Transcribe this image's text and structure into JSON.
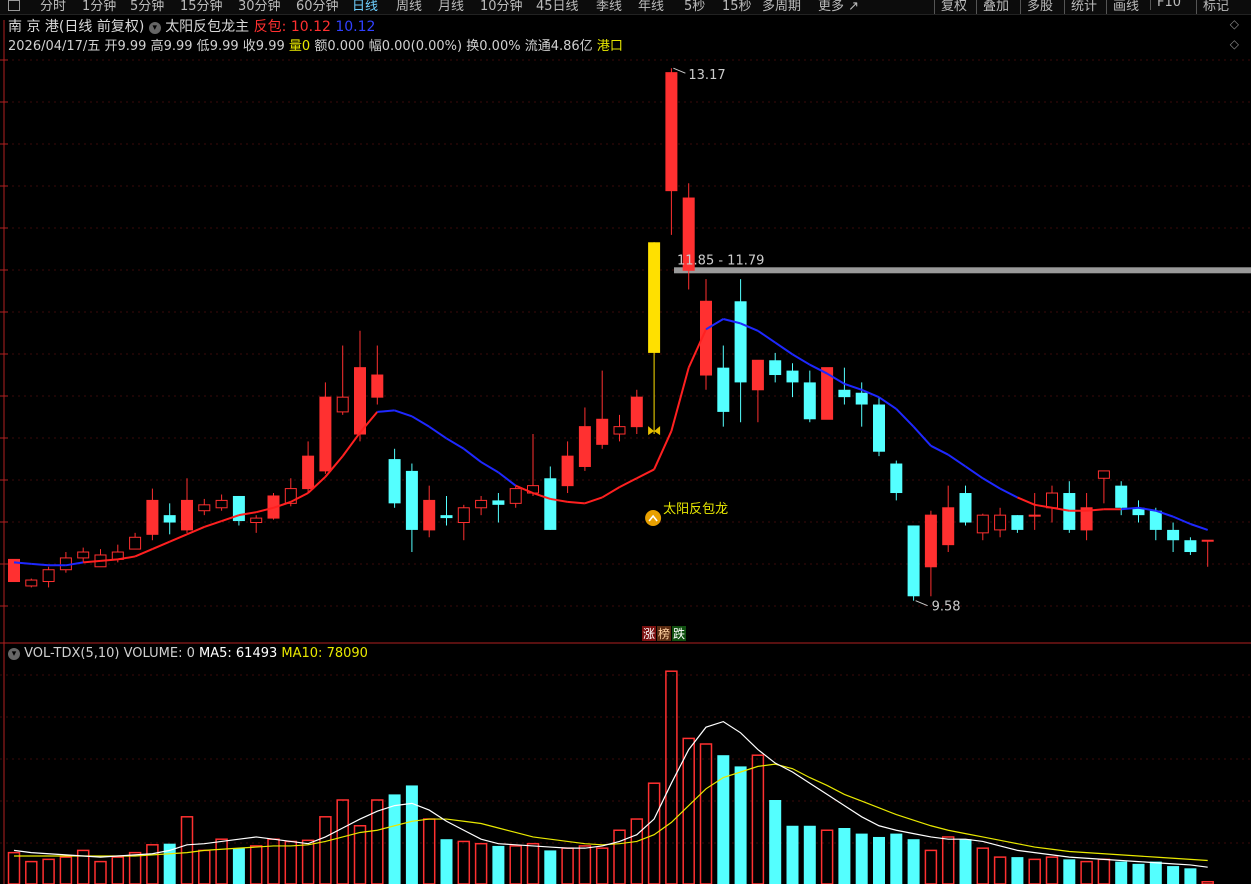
{
  "toolbar": {
    "items": [
      "分时",
      "1分钟",
      "5分钟",
      "15分钟",
      "30分钟",
      "60分钟",
      "日线",
      "周线",
      "月线",
      "10分钟",
      "45日线",
      "季线",
      "年线",
      "5秒",
      "15秒",
      "多周期",
      "更多"
    ],
    "active_index": 6,
    "right_items": [
      "复权",
      "叠加",
      "多股",
      "统计",
      "画线",
      "F10",
      "标记"
    ]
  },
  "header": {
    "stock_name": "南 京 港",
    "period": "(日线 前复权)",
    "indicator": "太阳反包龙主",
    "fanbao_label": "反包:",
    "fanbao_value": "10.12",
    "fanbao_value2": "10.12"
  },
  "quote": {
    "date": "2026/04/17/五",
    "open_label": "开",
    "open": "9.99",
    "high_label": "高",
    "high": "9.99",
    "low_label": "低",
    "low": "9.99",
    "close_label": "收",
    "close": "9.99",
    "vol_label": "量",
    "vol": "0",
    "amount_label": "额",
    "amount": "0.000",
    "change_label": "幅",
    "change": "0.00(0.00%)",
    "turnover_label": "换",
    "turnover": "0.00%",
    "float_label": "流通",
    "float_cap": "4.86亿",
    "tag": "港口"
  },
  "annotations": {
    "high_label": "13.17",
    "low_label": "9.58",
    "level_label": "11.85 - 11.79",
    "signal_text": "太阳反包龙",
    "zhang": "涨",
    "bang": "榜",
    "die": "跌"
  },
  "volume_panel": {
    "title": "VOL-TDX(5,10)",
    "volume_text": "VOLUME: 0",
    "ma5_text": "MA5: 61493",
    "ma10_text": "MA10: 78090"
  },
  "colors": {
    "up": "#ff3030",
    "down": "#54ffff",
    "ma_up": "#ff2020",
    "ma_down": "#1e28ff",
    "signal": "#ffe000",
    "vol_ma5": "#ffffff",
    "vol_ma10": "#e8e800",
    "level_line": "#9a9a9a"
  },
  "chart_data": {
    "type": "candlestick",
    "price_range": [
      9.3,
      13.3
    ],
    "volume_max": 200000,
    "candles": [
      {
        "o": 9.71,
        "c": 9.86,
        "h": 9.86,
        "l": 9.71
      },
      {
        "o": 9.68,
        "c": 9.72,
        "h": 9.73,
        "l": 9.67
      },
      {
        "o": 9.71,
        "c": 9.79,
        "h": 9.81,
        "l": 9.67
      },
      {
        "o": 9.79,
        "c": 9.87,
        "h": 9.91,
        "l": 9.77
      },
      {
        "o": 9.87,
        "c": 9.91,
        "h": 9.94,
        "l": 9.84
      },
      {
        "o": 9.81,
        "c": 9.89,
        "h": 9.93,
        "l": 9.81
      },
      {
        "o": 9.86,
        "c": 9.91,
        "h": 9.96,
        "l": 9.84
      },
      {
        "o": 9.93,
        "c": 10.01,
        "h": 10.04,
        "l": 9.93
      },
      {
        "o": 10.03,
        "c": 10.26,
        "h": 10.34,
        "l": 9.99
      },
      {
        "o": 10.16,
        "c": 10.11,
        "h": 10.24,
        "l": 10.03
      },
      {
        "o": 10.06,
        "c": 10.26,
        "h": 10.41,
        "l": 10.04
      },
      {
        "o": 10.19,
        "c": 10.23,
        "h": 10.27,
        "l": 10.16
      },
      {
        "o": 10.21,
        "c": 10.26,
        "h": 10.3,
        "l": 10.19
      },
      {
        "o": 10.29,
        "c": 10.12,
        "h": 10.29,
        "l": 10.09
      },
      {
        "o": 10.11,
        "c": 10.14,
        "h": 10.16,
        "l": 10.04
      },
      {
        "o": 10.14,
        "c": 10.29,
        "h": 10.31,
        "l": 10.13
      },
      {
        "o": 10.24,
        "c": 10.34,
        "h": 10.41,
        "l": 10.22
      },
      {
        "o": 10.34,
        "c": 10.56,
        "h": 10.66,
        "l": 10.31
      },
      {
        "o": 10.46,
        "c": 10.96,
        "h": 11.06,
        "l": 10.44
      },
      {
        "o": 10.86,
        "c": 10.96,
        "h": 11.31,
        "l": 10.84
      },
      {
        "o": 10.71,
        "c": 11.16,
        "h": 11.41,
        "l": 10.66
      },
      {
        "o": 10.96,
        "c": 11.11,
        "h": 11.31,
        "l": 10.91
      },
      {
        "o": 10.54,
        "c": 10.24,
        "h": 10.61,
        "l": 10.21
      },
      {
        "o": 10.46,
        "c": 10.06,
        "h": 10.51,
        "l": 9.91
      },
      {
        "o": 10.06,
        "c": 10.26,
        "h": 10.36,
        "l": 10.01
      },
      {
        "o": 10.16,
        "c": 10.14,
        "h": 10.29,
        "l": 10.09
      },
      {
        "o": 10.11,
        "c": 10.21,
        "h": 10.23,
        "l": 9.99
      },
      {
        "o": 10.21,
        "c": 10.26,
        "h": 10.29,
        "l": 10.16
      },
      {
        "o": 10.26,
        "c": 10.23,
        "h": 10.31,
        "l": 10.11
      },
      {
        "o": 10.24,
        "c": 10.34,
        "h": 10.36,
        "l": 10.21
      },
      {
        "o": 10.31,
        "c": 10.36,
        "h": 10.71,
        "l": 10.29
      },
      {
        "o": 10.41,
        "c": 10.06,
        "h": 10.49,
        "l": 10.06
      },
      {
        "o": 10.36,
        "c": 10.56,
        "h": 10.66,
        "l": 10.31
      },
      {
        "o": 10.49,
        "c": 10.76,
        "h": 10.89,
        "l": 10.46
      },
      {
        "o": 10.64,
        "c": 10.81,
        "h": 11.14,
        "l": 10.61
      },
      {
        "o": 10.71,
        "c": 10.76,
        "h": 10.84,
        "l": 10.66
      },
      {
        "o": 10.76,
        "c": 10.96,
        "h": 11.01,
        "l": 10.71
      },
      {
        "o": 11.26,
        "c": 12.01,
        "h": 12.01,
        "l": 10.71,
        "signal": true
      },
      {
        "o": 12.36,
        "c": 13.16,
        "h": 13.19,
        "l": 12.06
      },
      {
        "o": 11.82,
        "c": 12.31,
        "h": 12.41,
        "l": 11.69
      },
      {
        "o": 11.11,
        "c": 11.61,
        "h": 11.76,
        "l": 11.01
      },
      {
        "o": 11.16,
        "c": 10.86,
        "h": 11.31,
        "l": 10.76
      },
      {
        "o": 11.61,
        "c": 11.06,
        "h": 11.76,
        "l": 10.79
      },
      {
        "o": 11.01,
        "c": 11.21,
        "h": 11.21,
        "l": 10.79
      },
      {
        "o": 11.21,
        "c": 11.11,
        "h": 11.26,
        "l": 11.06
      },
      {
        "o": 11.14,
        "c": 11.06,
        "h": 11.19,
        "l": 10.96
      },
      {
        "o": 11.06,
        "c": 10.81,
        "h": 11.14,
        "l": 10.79
      },
      {
        "o": 10.81,
        "c": 11.16,
        "h": 11.16,
        "l": 10.81
      },
      {
        "o": 11.01,
        "c": 10.96,
        "h": 11.16,
        "l": 10.91
      },
      {
        "o": 10.99,
        "c": 10.91,
        "h": 11.06,
        "l": 10.76
      },
      {
        "o": 10.91,
        "c": 10.59,
        "h": 10.96,
        "l": 10.56
      },
      {
        "o": 10.51,
        "c": 10.31,
        "h": 10.53,
        "l": 10.26
      },
      {
        "o": 10.09,
        "c": 9.61,
        "h": 10.09,
        "l": 9.58
      },
      {
        "o": 9.81,
        "c": 10.16,
        "h": 10.19,
        "l": 9.61
      },
      {
        "o": 9.96,
        "c": 10.21,
        "h": 10.36,
        "l": 9.91
      },
      {
        "o": 10.31,
        "c": 10.11,
        "h": 10.36,
        "l": 10.09
      },
      {
        "o": 10.04,
        "c": 10.16,
        "h": 10.17,
        "l": 9.99
      },
      {
        "o": 10.06,
        "c": 10.16,
        "h": 10.21,
        "l": 10.01
      },
      {
        "o": 10.16,
        "c": 10.06,
        "h": 10.16,
        "l": 10.04
      },
      {
        "o": 10.16,
        "c": 10.16,
        "h": 10.31,
        "l": 10.06
      },
      {
        "o": 10.21,
        "c": 10.31,
        "h": 10.36,
        "l": 10.11
      },
      {
        "o": 10.31,
        "c": 10.06,
        "h": 10.39,
        "l": 10.04
      },
      {
        "o": 10.06,
        "c": 10.21,
        "h": 10.31,
        "l": 9.99
      },
      {
        "o": 10.41,
        "c": 10.46,
        "h": 10.46,
        "l": 10.24
      },
      {
        "o": 10.36,
        "c": 10.21,
        "h": 10.39,
        "l": 10.16
      },
      {
        "o": 10.21,
        "c": 10.16,
        "h": 10.26,
        "l": 10.11
      },
      {
        "o": 10.19,
        "c": 10.06,
        "h": 10.21,
        "l": 9.99
      },
      {
        "o": 10.06,
        "c": 9.99,
        "h": 10.11,
        "l": 9.91
      },
      {
        "o": 9.99,
        "c": 9.91,
        "h": 10.01,
        "l": 9.89
      },
      {
        "o": 9.99,
        "c": 9.99,
        "h": 9.99,
        "l": 9.81
      }
    ],
    "volume": [
      28000,
      20000,
      22000,
      24000,
      30000,
      20000,
      24000,
      28000,
      35000,
      36000,
      60000,
      30000,
      40000,
      32000,
      34000,
      40000,
      38000,
      39000,
      60000,
      75000,
      52000,
      75000,
      80000,
      88000,
      58000,
      40000,
      38000,
      36000,
      34000,
      34000,
      36000,
      30000,
      32000,
      34000,
      32000,
      48000,
      58000,
      90000,
      190000,
      130000,
      125000,
      115000,
      105000,
      115000,
      75000,
      52000,
      52000,
      48000,
      50000,
      45000,
      42000,
      45000,
      40000,
      30000,
      42000,
      40000,
      32000,
      24000,
      24000,
      22000,
      24000,
      22000,
      20000,
      22000,
      20000,
      18000,
      20000,
      16000,
      14000,
      2000
    ],
    "ma_line": [
      9.84,
      9.83,
      9.82,
      9.82,
      9.84,
      9.85,
      9.86,
      9.88,
      9.93,
      9.98,
      10.03,
      10.08,
      10.12,
      10.16,
      10.18,
      10.21,
      10.25,
      10.31,
      10.42,
      10.56,
      10.72,
      10.86,
      10.87,
      10.83,
      10.76,
      10.68,
      10.61,
      10.52,
      10.45,
      10.36,
      10.31,
      10.27,
      10.25,
      10.24,
      10.28,
      10.35,
      10.41,
      10.47,
      10.73,
      11.16,
      11.42,
      11.49,
      11.46,
      11.41,
      11.33,
      11.25,
      11.18,
      11.12,
      11.05,
      11.01,
      10.96,
      10.88,
      10.76,
      10.63,
      10.57,
      10.49,
      10.41,
      10.34,
      10.28,
      10.23,
      10.21,
      10.19,
      10.19,
      10.2,
      10.2,
      10.21,
      10.19,
      10.15,
      10.1,
      10.06
    ],
    "ma_trend": [
      -1,
      -1,
      -1,
      -1,
      -1,
      1,
      1,
      1,
      1,
      1,
      1,
      1,
      1,
      1,
      1,
      1,
      1,
      1,
      1,
      1,
      1,
      1,
      -1,
      -1,
      -1,
      -1,
      -1,
      -1,
      -1,
      -1,
      1,
      1,
      1,
      1,
      1,
      1,
      1,
      1,
      1,
      1,
      1,
      -1,
      -1,
      -1,
      -1,
      -1,
      -1,
      -1,
      -1,
      -1,
      -1,
      -1,
      -1,
      -1,
      -1,
      -1,
      -1,
      -1,
      -1,
      1,
      1,
      1,
      1,
      1,
      1,
      -1,
      -1,
      -1,
      -1,
      -1
    ],
    "vol_ma5": [
      30000,
      28000,
      27000,
      26000,
      25000,
      24000,
      25000,
      26000,
      27000,
      30000,
      35000,
      36000,
      38000,
      40000,
      42000,
      40000,
      38000,
      36000,
      42000,
      50000,
      58000,
      65000,
      70000,
      72000,
      66000,
      56000,
      48000,
      40000,
      36000,
      35000,
      34000,
      33000,
      32000,
      32000,
      34000,
      38000,
      44000,
      58000,
      90000,
      120000,
      140000,
      145000,
      135000,
      120000,
      108000,
      100000,
      90000,
      80000,
      70000,
      60000,
      52000,
      48000,
      45000,
      42000,
      40000,
      40000,
      38000,
      34000,
      30000,
      28000,
      26000,
      24000,
      23000,
      22000,
      21000,
      20000,
      19000,
      18000,
      17000,
      15000
    ],
    "vol_ma10": [
      25000,
      25000,
      25000,
      25000,
      25000,
      25000,
      25000,
      25000,
      26000,
      27000,
      28000,
      30000,
      31000,
      32000,
      33000,
      34000,
      34000,
      35000,
      38000,
      42000,
      46000,
      48000,
      52000,
      56000,
      58000,
      58000,
      56000,
      54000,
      50000,
      46000,
      42000,
      40000,
      38000,
      36000,
      35000,
      36000,
      38000,
      44000,
      55000,
      70000,
      85000,
      95000,
      100000,
      105000,
      107000,
      103000,
      95000,
      88000,
      80000,
      74000,
      68000,
      62000,
      57000,
      52000,
      48000,
      45000,
      42000,
      39000,
      36000,
      33000,
      31000,
      29000,
      28000,
      27000,
      26000,
      25000,
      24000,
      23000,
      22000,
      21000
    ]
  }
}
